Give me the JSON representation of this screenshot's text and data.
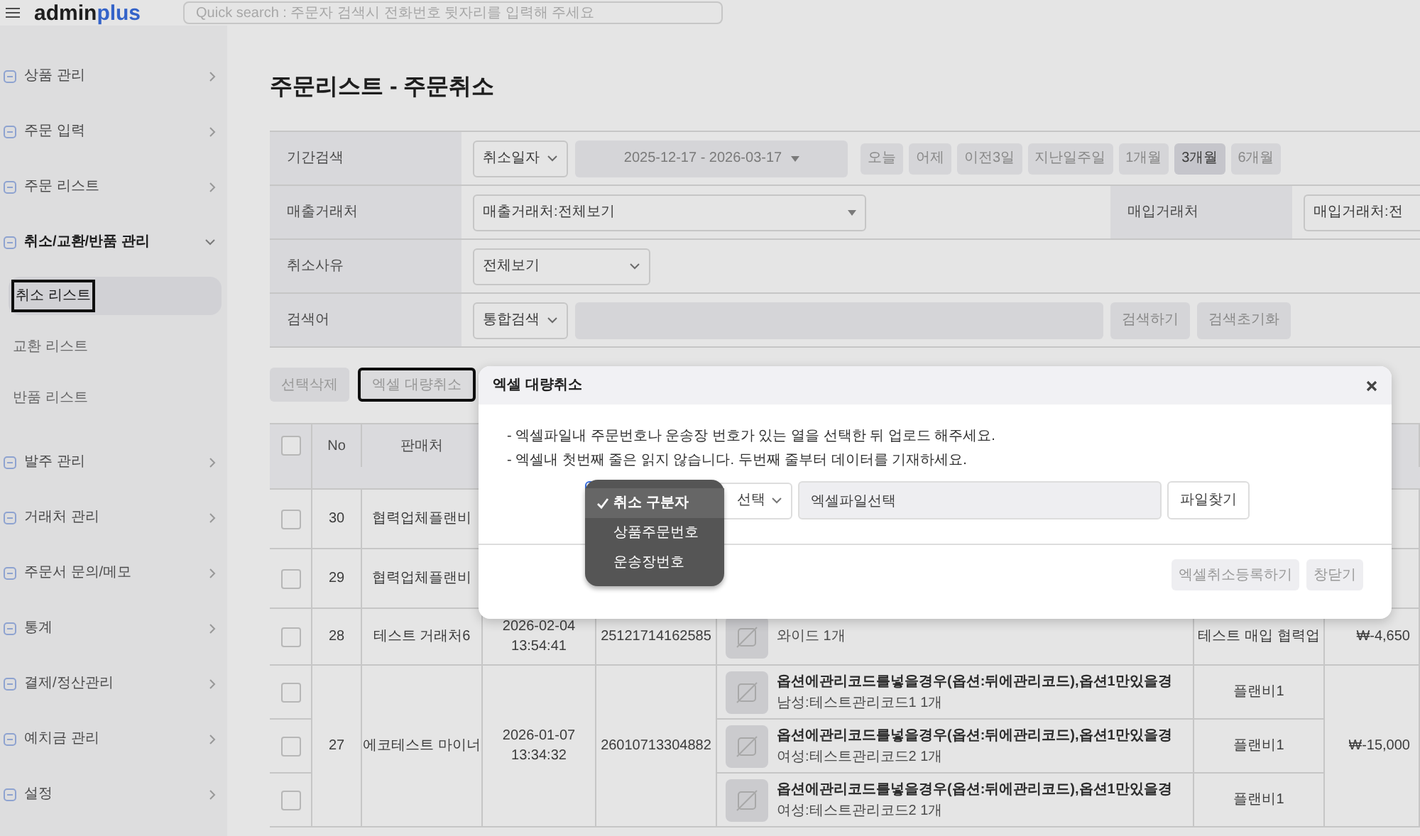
{
  "header": {
    "logo_main": "admin",
    "logo_accent": "plus",
    "search_placeholder": "Quick search : 주문자 검색시 전화번호 뒷자리를 입력해 주세요"
  },
  "sidebar": {
    "items": [
      {
        "label": "상품 관리",
        "expanded": false
      },
      {
        "label": "주문 입력",
        "expanded": false
      },
      {
        "label": "주문 리스트",
        "expanded": false
      },
      {
        "label": "취소/교환/반품 관리",
        "expanded": true,
        "children": [
          {
            "label": "취소 리스트",
            "selected": true
          },
          {
            "label": "교환 리스트",
            "selected": false
          },
          {
            "label": "반품 리스트",
            "selected": false
          }
        ]
      },
      {
        "label": "발주 관리",
        "expanded": false
      },
      {
        "label": "거래처 관리",
        "expanded": false
      },
      {
        "label": "주문서 문의/메모",
        "expanded": false
      },
      {
        "label": "통계",
        "expanded": false
      },
      {
        "label": "결제/정산관리",
        "expanded": false
      },
      {
        "label": "예치금 관리",
        "expanded": false
      },
      {
        "label": "설정",
        "expanded": false
      }
    ]
  },
  "page_title": "주문리스트 - 주문취소",
  "filters": {
    "period": {
      "label": "기간검색",
      "type_select": "취소일자",
      "date_range": "2025-12-17 - 2026-03-17",
      "quick_ranges": [
        {
          "label": "오늘",
          "selected": false
        },
        {
          "label": "어제",
          "selected": false
        },
        {
          "label": "이전3일",
          "selected": false
        },
        {
          "label": "지난일주일",
          "selected": false
        },
        {
          "label": "1개월",
          "selected": false
        },
        {
          "label": "3개월",
          "selected": true
        },
        {
          "label": "6개월",
          "selected": false
        }
      ]
    },
    "seller": {
      "label": "매출거래처",
      "select": "매출거래처:전체보기",
      "buyer_label": "매입거래처",
      "buyer_select": "매입거래처:전"
    },
    "reason": {
      "label": "취소사유",
      "select": "전체보기"
    },
    "keyword": {
      "label": "검색어",
      "select": "통합검색",
      "buttons": [
        "검색하기",
        "검색초기화"
      ]
    }
  },
  "actions": [
    {
      "label": "선택삭제",
      "focused": false
    },
    {
      "label": "엑셀 대량취소",
      "focused": true
    }
  ],
  "table": {
    "columns": [
      "No",
      "판매처"
    ],
    "header_checked": false,
    "rows": [
      {
        "no": "30",
        "seller": "협력업체플랜비",
        "items": [
          {
            "checked": false
          }
        ]
      },
      {
        "no": "29",
        "seller": "협력업체플랜비",
        "items": [
          {
            "checked": false
          }
        ]
      },
      {
        "no": "28",
        "seller": "테스트 거래처6",
        "date": "2026-02-04",
        "time": "13:54:41",
        "order_no": "25121714162585",
        "price": "₩-4,650",
        "items": [
          {
            "checked": false,
            "option": "와이드 1개",
            "supplier": "테스트 매입 협력업"
          }
        ]
      },
      {
        "no": "27",
        "seller": "에코테스트 마이너",
        "date": "2026-01-07",
        "time": "13:34:32",
        "order_no": "26010713304882",
        "price": "₩-15,000",
        "items": [
          {
            "checked": false,
            "name": "옵션에관리코드를넣을경우(옵션:뒤에관리코드),옵션1만있을경",
            "option": "남성:테스트관리코드1 1개",
            "supplier": "플랜비1"
          },
          {
            "checked": false,
            "name": "옵션에관리코드를넣을경우(옵션:뒤에관리코드),옵션1만있을경",
            "option": "여성:테스트관리코드2 1개",
            "supplier": "플랜비1"
          },
          {
            "checked": false,
            "name": "옵션에관리코드를넣을경우(옵션:뒤에관리코드),옵션1만있을경",
            "option": "여성:테스트관리코드2 1개",
            "supplier": "플랜비1"
          }
        ]
      }
    ]
  },
  "modal": {
    "title": "엑셀 대량취소",
    "notes": [
      "- 엑셀파일내 주문번호나 운송장 번호가 있는 열을 선택한 뒤 업로드 해주세요.",
      "- 엑셀내 첫번째 줄은 읽지 않습니다. 두번째 줄부터 데이터를 기재하세요."
    ],
    "column_select": "선택",
    "file_field": {
      "value": "엑셀파일선택"
    },
    "file_button": "파일찾기",
    "dropdown": [
      {
        "label": "취소 구분자",
        "selected": true
      },
      {
        "label": "상품주문번호",
        "selected": false
      },
      {
        "label": "운송장번호",
        "selected": false
      }
    ],
    "footer_buttons": [
      "엑셀취소등록하기",
      "창닫기"
    ]
  }
}
